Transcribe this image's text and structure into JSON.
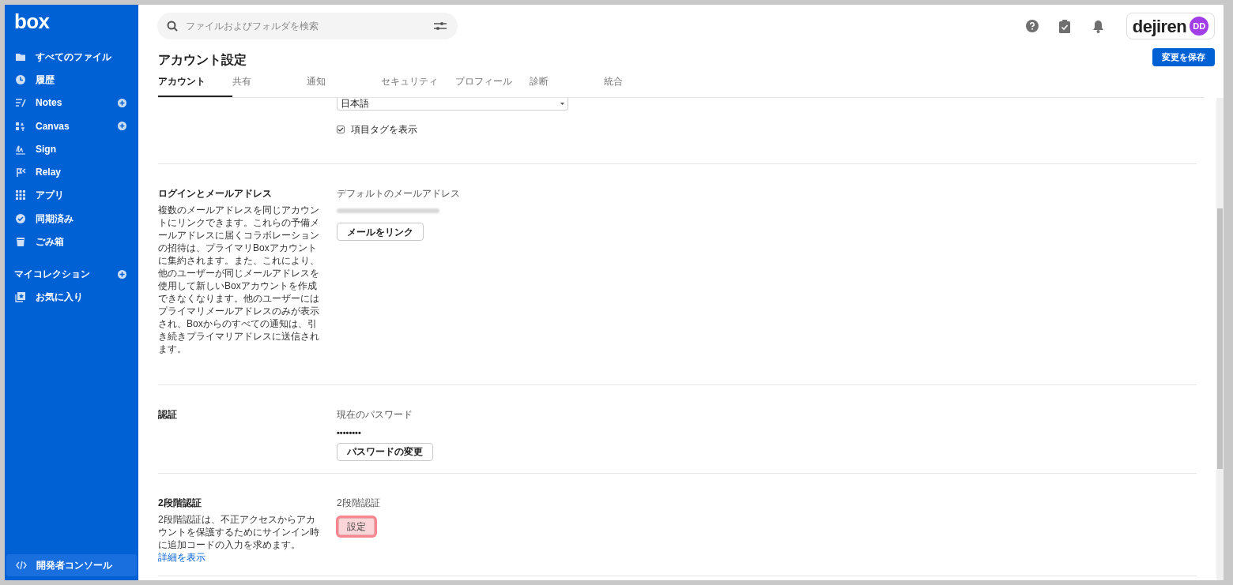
{
  "sidebar": {
    "logo": "box",
    "items": [
      {
        "label": "すべてのファイル",
        "add": false
      },
      {
        "label": "履歴",
        "add": false
      },
      {
        "label": "Notes",
        "add": true
      },
      {
        "label": "Canvas",
        "add": true
      },
      {
        "label": "Sign",
        "add": false
      },
      {
        "label": "Relay",
        "add": false
      },
      {
        "label": "アプリ",
        "add": false
      },
      {
        "label": "同期済み",
        "add": false
      },
      {
        "label": "ごみ箱",
        "add": false
      }
    ],
    "collections": {
      "title": "マイコレクション",
      "items": [
        {
          "label": "お気に入り"
        }
      ]
    },
    "footer": {
      "label": "開発者コンソール"
    }
  },
  "search": {
    "placeholder": "ファイルおよびフォルダを検索"
  },
  "account": {
    "brand": "dejiren",
    "initials": "DD"
  },
  "page": {
    "title": "アカウント設定",
    "save_button": "変更を保存"
  },
  "tabs": [
    {
      "label": "アカウント",
      "selected": true
    },
    {
      "label": "共有",
      "selected": false
    },
    {
      "label": "通知",
      "selected": false
    },
    {
      "label": "セキュリティ",
      "selected": false
    },
    {
      "label": "プロフィール",
      "selected": false
    },
    {
      "label": "診断",
      "selected": false
    },
    {
      "label": "統合",
      "selected": false
    }
  ],
  "sections": [
    {
      "fields": [
        {
          "kind": "select",
          "value": "日本語"
        },
        {
          "kind": "checkbox",
          "label": "項目タグを表示",
          "checked": true
        }
      ]
    },
    {
      "title": "ログインとメールアドレス",
      "description": "複数のメールアドレスを同じアカウントにリンクできます。これらの予備メールアドレスに届くコラボレーションの招待は、プライマリBoxアカウントに集約されます。また、これにより、他のユーザーが同じメールアドレスを使用して新しいBoxアカウントを作成できなくなります。他のユーザーにはプライマリメールアドレスのみが表示され、Boxからのすべての通知は、引き続きプライマリアドレスに送信されます。",
      "fields": [
        {
          "kind": "label",
          "text": "デフォルトのメールアドレス"
        },
        {
          "kind": "blurred"
        },
        {
          "kind": "button",
          "text": "メールをリンク",
          "highlighted": false
        }
      ]
    },
    {
      "title": "認証",
      "fields": [
        {
          "kind": "label",
          "text": "現在のパスワード"
        },
        {
          "kind": "value",
          "text": "••••••••"
        },
        {
          "kind": "button",
          "text": "パスワードの変更",
          "highlighted": false
        }
      ]
    },
    {
      "title": "2段階認証",
      "description": "2段階認証は、不正アクセスからアカウントを保護するためにサインイン時に追加コードの入力を求めます。",
      "link": "詳細を表示",
      "fields": [
        {
          "kind": "label",
          "text": "2段階認証"
        },
        {
          "kind": "button",
          "text": "設定",
          "highlighted": true
        }
      ]
    }
  ]
}
